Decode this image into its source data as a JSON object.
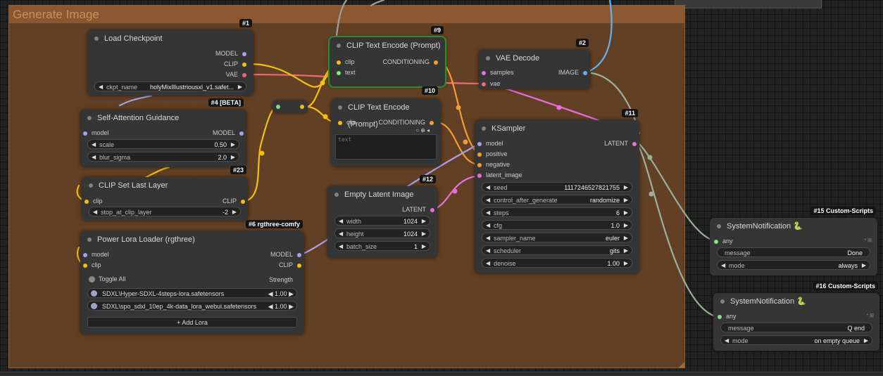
{
  "group": {
    "title": "Generate Image"
  },
  "nodes": {
    "load_checkpoint": {
      "badge": "#1",
      "title": "Load Checkpoint",
      "outputs": [
        "MODEL",
        "CLIP",
        "VAE"
      ],
      "widget": {
        "label": "ckpt_name",
        "value": "holyMixIllustriousxl_v1.safet..."
      }
    },
    "clip_text_encode_9": {
      "badge": "#9",
      "title": "CLIP Text Encode (Prompt)",
      "inputs": [
        "clip",
        "text"
      ],
      "output": "CONDITIONING"
    },
    "clip_text_encode_10": {
      "badge": "#10",
      "title": "CLIP Text Encode (Prompt)",
      "input": "clip",
      "output": "CONDITIONING",
      "textarea_placeholder": "text"
    },
    "vae_decode": {
      "badge": "#2",
      "title": "VAE Decode",
      "inputs": [
        "samples",
        "vae"
      ],
      "output": "IMAGE"
    },
    "self_attention": {
      "badge": "#4 [BETA]",
      "title": "Self-Attention Guidance",
      "input": "model",
      "output": "MODEL",
      "widgets": [
        {
          "label": "scale",
          "value": "0.50"
        },
        {
          "label": "blur_sigma",
          "value": "2.0"
        }
      ]
    },
    "clip_set_last_layer": {
      "badge": "#23",
      "title": "CLIP Set Last Layer",
      "input": "clip",
      "output": "CLIP",
      "widget": {
        "label": "stop_at_clip_layer",
        "value": "-2"
      }
    },
    "power_lora": {
      "badge": "#6 rgthree-comfy",
      "title": "Power Lora Loader (rgthree)",
      "inputs": [
        "model",
        "clip"
      ],
      "outputs": [
        "MODEL",
        "CLIP"
      ],
      "toggle_all": "Toggle All",
      "strength_header": "Strength",
      "loras": [
        {
          "name": "SDXL\\Hyper-SDXL-4steps-lora.safetensors",
          "strength": "1.00"
        },
        {
          "name": "SDXL\\spo_sdxl_10ep_4k-data_lora_webui.safetensors",
          "strength": "1.00"
        }
      ],
      "add_label": "+ Add Lora"
    },
    "empty_latent": {
      "badge": "#12",
      "title": "Empty Latent Image",
      "output": "LATENT",
      "widgets": [
        {
          "label": "width",
          "value": "1024"
        },
        {
          "label": "height",
          "value": "1024"
        },
        {
          "label": "batch_size",
          "value": "1"
        }
      ]
    },
    "ksampler": {
      "badge": "#11",
      "title": "KSampler",
      "inputs": [
        "model",
        "positive",
        "negative",
        "latent_image"
      ],
      "output": "LATENT",
      "widgets": [
        {
          "label": "seed",
          "value": "1117246527821755"
        },
        {
          "label": "control_after_generate",
          "value": "randomize"
        },
        {
          "label": "steps",
          "value": "6"
        },
        {
          "label": "cfg",
          "value": "1.0"
        },
        {
          "label": "sampler_name",
          "value": "euler"
        },
        {
          "label": "scheduler",
          "value": "gits"
        },
        {
          "label": "denoise",
          "value": "1.00"
        }
      ]
    },
    "notify_15": {
      "badge": "#15 Custom-Scripts",
      "title": "SystemNotification",
      "title_icon": "snake-icon",
      "input": "any",
      "widgets": [
        {
          "label": "message",
          "value": "Done"
        },
        {
          "label": "mode",
          "value": "always"
        }
      ]
    },
    "notify_16": {
      "badge": "#16 Custom-Scripts",
      "title": "SystemNotification",
      "title_icon": "snake-icon",
      "input": "any",
      "widgets": [
        {
          "label": "message",
          "value": "Q end"
        },
        {
          "label": "mode",
          "value": "on empty queue"
        }
      ]
    }
  },
  "colors": {
    "group_bg": "#684326",
    "node_bg": "#353535",
    "model": "#a8a0ea",
    "clip": "#f2c10f",
    "vae": "#f06a6a",
    "conditioning": "#f39c34",
    "latent": "#e96edc",
    "image": "#62b2f0",
    "selected_outline": "#2e8b2e"
  }
}
